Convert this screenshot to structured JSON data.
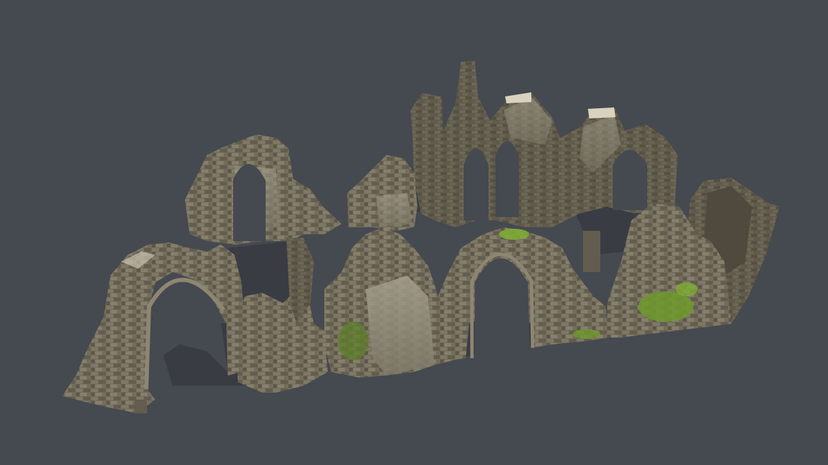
{
  "scene": {
    "subject": "ruin-walls-3d-render",
    "colors": {
      "background": "#454950",
      "stone_dark": "#5a5548",
      "stone_mid": "#7a7462",
      "stone_light": "#a39c88",
      "plaster": "#9a9685",
      "moss": "#6f9a2c",
      "shadow": "#34373d"
    }
  }
}
